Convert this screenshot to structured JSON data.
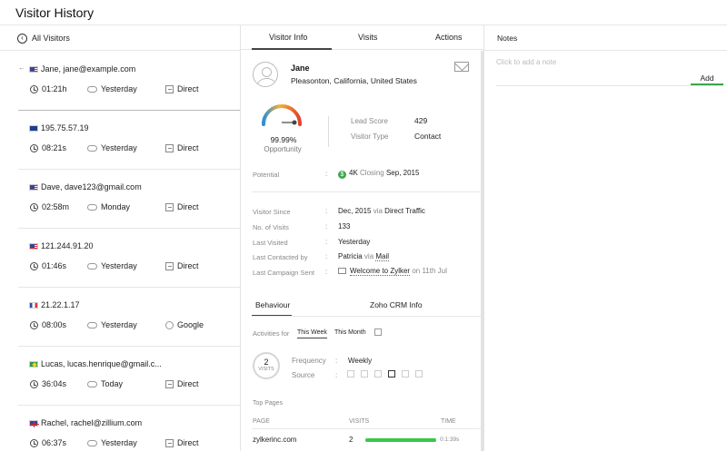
{
  "app": {
    "title": "Visitor History"
  },
  "left": {
    "back_label": "All Visitors",
    "visitors": [
      {
        "flag": "us",
        "name": "Jane, jane@example.com",
        "time": "01:21h",
        "day": "Yesterday",
        "source": "Direct",
        "source_icon": "direct-icon",
        "active": true
      },
      {
        "flag": "au",
        "name": "195.75.57.19",
        "time": "08:21s",
        "day": "Yesterday",
        "source": "Direct",
        "source_icon": "direct-icon"
      },
      {
        "flag": "us",
        "name": "Dave, dave123@gmail.com",
        "time": "02:58m",
        "day": "Monday",
        "source": "Direct",
        "source_icon": "direct-icon"
      },
      {
        "flag": "us",
        "name": "121.244.91.20",
        "time": "01:46s",
        "day": "Yesterday",
        "source": "Direct",
        "source_icon": "direct-icon"
      },
      {
        "flag": "fr",
        "name": "21.22.1.17",
        "time": "08:00s",
        "day": "Yesterday",
        "source": "Google",
        "source_icon": "google-icon"
      },
      {
        "flag": "br",
        "name": "Lucas, lucas.henrique@gmail.c...",
        "time": "36:04s",
        "day": "Today",
        "source": "Direct",
        "source_icon": "direct-icon"
      },
      {
        "flag": "uk",
        "name": "Rachel, rachel@zillium.com",
        "time": "06:37s",
        "day": "Yesterday",
        "source": "Direct",
        "source_icon": "direct-icon"
      }
    ]
  },
  "mid": {
    "tabs": [
      "Visitor Info",
      "Visits",
      "Actions"
    ],
    "profile": {
      "name": "Jane",
      "location": "Pleasonton, California, United States"
    },
    "gauge": {
      "percent_label": "99.99%",
      "label": "Opportunity",
      "value": 0.9999
    },
    "lead_score_label": "Lead Score",
    "lead_score": "429",
    "visitor_type_label": "Visitor Type",
    "visitor_type": "Contact",
    "potential_label": "Potential",
    "potential_amount": "4K",
    "potential_closing": "Closing",
    "potential_date": "Sep, 2015",
    "details": {
      "since_label": "Visitor Since",
      "since_value": "Dec, 2015",
      "since_via": "via",
      "since_channel": "Direct Traffic",
      "visits_label": "No. of Visits",
      "visits_value": "133",
      "last_visited_label": "Last Visited",
      "last_visited_value": "Yesterday",
      "last_contacted_label": "Last Contacted by",
      "last_contacted_value": "Patricia",
      "last_contacted_via": "via",
      "last_contacted_channel": "Mail",
      "campaign_label": "Last Campaign Sent",
      "campaign_value": "Welcome to Zylker",
      "campaign_on": "on 11th Jul"
    },
    "subtabs": [
      "Behaviour",
      "Zoho CRM Info"
    ],
    "activities_label": "Activities for",
    "period_options": [
      "This Week",
      "This Month"
    ],
    "visits_count": "2",
    "visits_unit": "VISITS",
    "frequency_label": "Frequency",
    "frequency_value": "Weekly",
    "source_label": "Source",
    "top_pages_label": "Top Pages",
    "columns": [
      "PAGE",
      "VISITS",
      "TIME"
    ],
    "top_pages": [
      {
        "page": "zylkerinc.com",
        "visits": "2",
        "progress": 1.0,
        "time": "0:1:39s"
      }
    ]
  },
  "right": {
    "title": "Notes",
    "placeholder": "Click to add a note",
    "add_label": "Add"
  },
  "colors": {
    "accent": "#3aa64a",
    "bar": "#3ac64a"
  }
}
